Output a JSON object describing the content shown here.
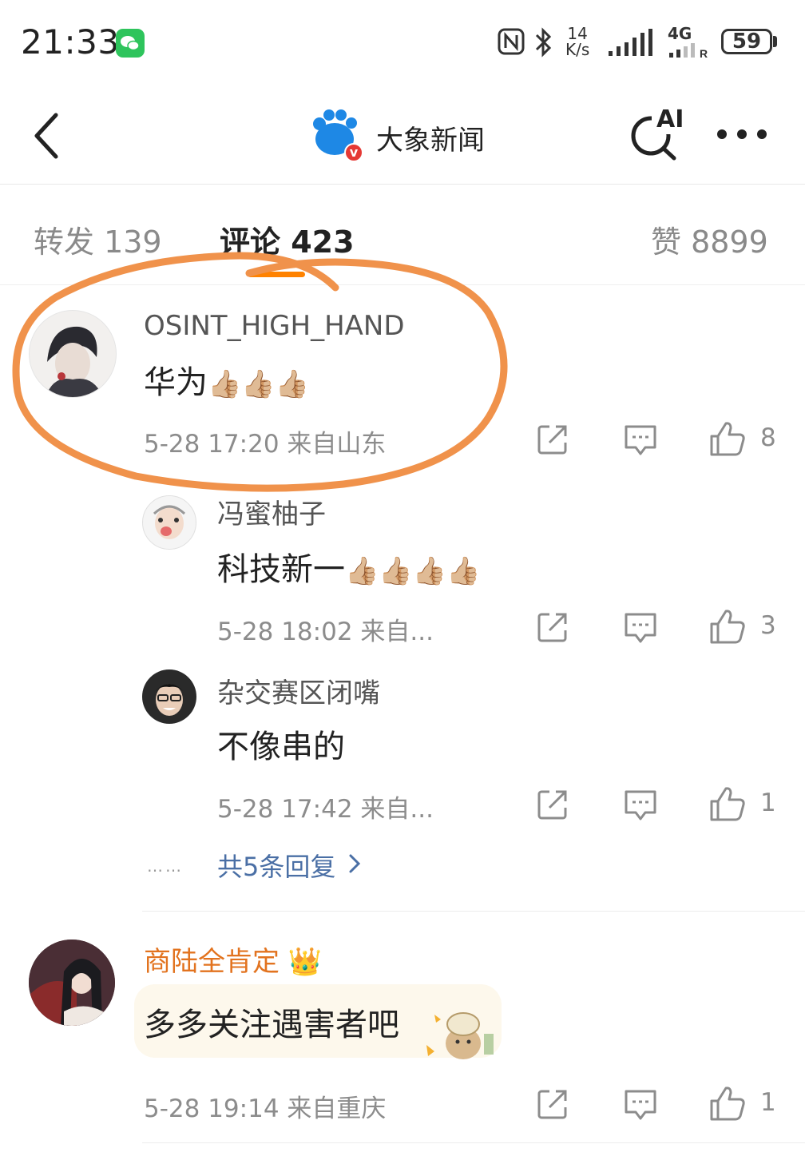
{
  "status_bar": {
    "time": "21:33",
    "net_speed_top": "14",
    "net_speed_bottom": "K/s",
    "network": "4G",
    "battery": "59",
    "icons": [
      "wechat-icon",
      "nfc-icon",
      "bluetooth-icon",
      "signal-icon",
      "signal-4g-icon",
      "battery-icon"
    ]
  },
  "header": {
    "title": "大象新闻",
    "back_icon": "chevron-left-icon",
    "ai_label": "AI",
    "ai_icon": "ai-search-icon",
    "more_icon": "more-dots-icon",
    "verified_badge": "v"
  },
  "tabs": [
    {
      "label": "转发 139",
      "active": false
    },
    {
      "label": "评论 423",
      "active": true
    },
    {
      "label": "赞 8899",
      "active": false
    }
  ],
  "comments": [
    {
      "username": "OSINT_HIGH_HAND",
      "text": "华为",
      "emoji": "👍🏼👍🏼👍🏼",
      "meta": "5-28 17:20  来自山东",
      "likes": "8",
      "replies": [
        {
          "username": "冯蜜柚子",
          "text": "科技新一",
          "emoji": "👍🏼👍🏼👍🏼👍🏼",
          "meta": "5-28 18:02  来自...",
          "likes": "3"
        },
        {
          "username": "杂交赛区闭嘴",
          "text": "不像串的",
          "emoji": "",
          "meta": "5-28 17:42  来自...",
          "likes": "1"
        }
      ],
      "more_replies": "共5条回复",
      "more_dots": "……"
    },
    {
      "username": "商陆全肯定",
      "username_badge": "👑",
      "text": "多多关注遇害者吧",
      "meta": "5-28 19:14  来自重庆",
      "likes": "1"
    }
  ],
  "colors": {
    "accent": "#ff8200",
    "annotation_circle": "#f0924b",
    "link": "#4a6fa5",
    "vip_name": "#e2731f"
  }
}
